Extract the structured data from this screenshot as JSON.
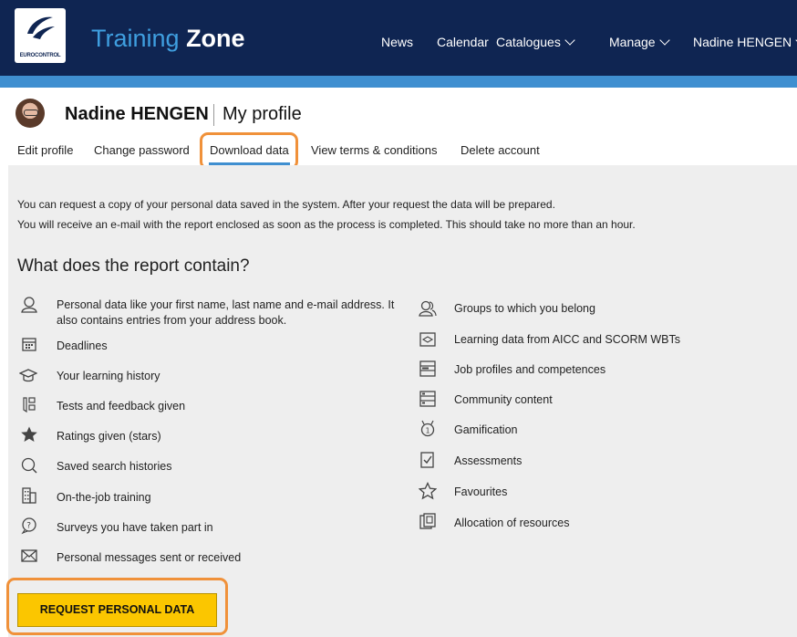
{
  "header": {
    "logo_text": "EUROCONTROL",
    "title_first": "Training",
    "title_second": "Zone",
    "nav": {
      "news": "News",
      "calendar": "Calendar",
      "catalogues": "Catalogues",
      "manage": "Manage",
      "user": "Nadine HENGEN"
    }
  },
  "profile": {
    "name": "Nadine HENGEN",
    "section": "My profile",
    "tabs": {
      "edit": "Edit profile",
      "password": "Change password",
      "download": "Download data",
      "terms": "View terms & conditions",
      "delete": "Delete account"
    }
  },
  "content": {
    "intro_line1": "You can request a copy of your personal data saved in the system. After your request the data will be prepared.",
    "intro_line2": "You will receive an e-mail with the report enclosed as soon as the process is completed. This should take no more than an hour.",
    "heading": "What does the report contain?",
    "left_items": {
      "personal_1": "Personal data like your first name, last name and e-mail address. It",
      "personal_2": "also contains entries from your address book.",
      "deadlines": "Deadlines",
      "history": "Your learning history",
      "tests": "Tests and feedback given",
      "ratings": "Ratings given (stars)",
      "search": "Saved search histories",
      "ojt": "On-the-job training",
      "surveys": "Surveys you have taken part in",
      "messages": "Personal messages sent or received"
    },
    "right_items": {
      "groups": "Groups to which you belong",
      "learning": "Learning data from AICC and SCORM WBTs",
      "job": "Job profiles and competences",
      "community": "Community content",
      "gamification": "Gamification",
      "assessments": "Assessments",
      "favourites": "Favourites",
      "allocation": "Allocation of resources"
    },
    "button": "REQUEST PERSONAL DATA"
  },
  "colors": {
    "header_bg": "#0f2552",
    "accent_blue": "#3f8fd0",
    "highlight": "#f0913a",
    "button_bg": "#fbc600"
  }
}
